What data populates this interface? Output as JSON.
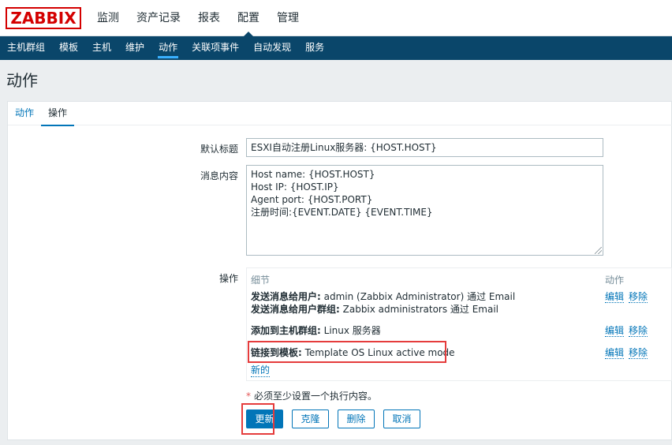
{
  "logo": "ZABBIX",
  "topnav": [
    "监测",
    "资产记录",
    "报表",
    "配置",
    "管理"
  ],
  "subnav": [
    "主机群组",
    "模板",
    "主机",
    "维护",
    "动作",
    "关联项事件",
    "自动发现",
    "服务"
  ],
  "page_title": "动作",
  "tabs": [
    "动作",
    "操作"
  ],
  "form": {
    "default_subject_label": "默认标题",
    "default_subject_value": "ESXI自动注册Linux服务器: {HOST.HOST}",
    "message_label": "消息内容",
    "message_lines": [
      "Host name: {HOST.HOST}",
      "Host IP: {HOST.IP}",
      "Agent port: {HOST.PORT}",
      "注册时间:{EVENT.DATE} {EVENT.TIME}"
    ],
    "operations_label": "操作"
  },
  "operations": {
    "col_details": "细节",
    "col_action": "动作",
    "rows": [
      {
        "lines": [
          {
            "bold": "发送消息给用户:",
            "text": " admin (Zabbix Administrator) 通过 Email"
          },
          {
            "bold": "发送消息给用户群组:",
            "text": " Zabbix administrators 通过 Email"
          }
        ]
      },
      {
        "lines": [
          {
            "bold": "添加到主机群组:",
            "text": " Linux 服务器"
          }
        ]
      },
      {
        "lines": [
          {
            "bold": "链接到模板:",
            "text": " Template OS Linux active mode"
          }
        ]
      }
    ],
    "edit_label": "编辑",
    "remove_label": "移除",
    "new_label": "新的"
  },
  "required_note": "必须至少设置一个执行内容。",
  "buttons": {
    "update": "更新",
    "clone": "克隆",
    "delete": "删除",
    "cancel": "取消"
  },
  "colors": {
    "brand_red": "#d40000",
    "nav_blue": "#0a466a",
    "link_blue": "#0275b8",
    "annotation_red": "#e53c3c"
  }
}
